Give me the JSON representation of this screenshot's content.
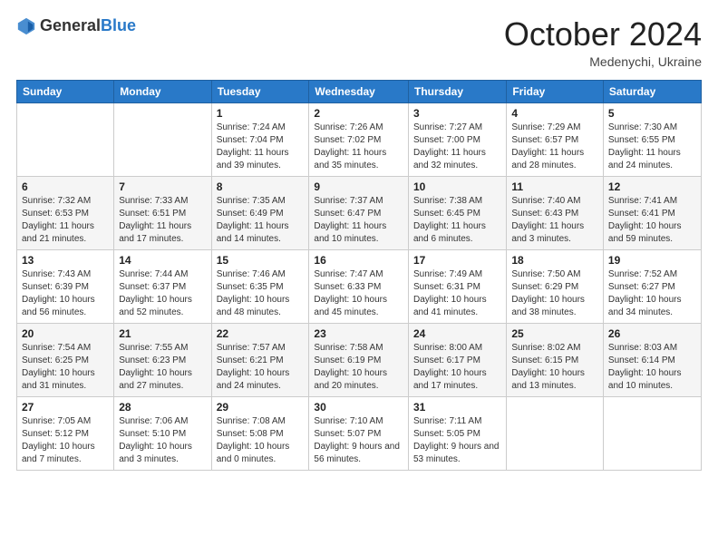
{
  "logo": {
    "general": "General",
    "blue": "Blue"
  },
  "header": {
    "month": "October 2024",
    "location": "Medenychi, Ukraine"
  },
  "weekdays": [
    "Sunday",
    "Monday",
    "Tuesday",
    "Wednesday",
    "Thursday",
    "Friday",
    "Saturday"
  ],
  "weeks": [
    [
      {
        "day": "",
        "info": ""
      },
      {
        "day": "",
        "info": ""
      },
      {
        "day": "1",
        "info": "Sunrise: 7:24 AM\nSunset: 7:04 PM\nDaylight: 11 hours and 39 minutes."
      },
      {
        "day": "2",
        "info": "Sunrise: 7:26 AM\nSunset: 7:02 PM\nDaylight: 11 hours and 35 minutes."
      },
      {
        "day": "3",
        "info": "Sunrise: 7:27 AM\nSunset: 7:00 PM\nDaylight: 11 hours and 32 minutes."
      },
      {
        "day": "4",
        "info": "Sunrise: 7:29 AM\nSunset: 6:57 PM\nDaylight: 11 hours and 28 minutes."
      },
      {
        "day": "5",
        "info": "Sunrise: 7:30 AM\nSunset: 6:55 PM\nDaylight: 11 hours and 24 minutes."
      }
    ],
    [
      {
        "day": "6",
        "info": "Sunrise: 7:32 AM\nSunset: 6:53 PM\nDaylight: 11 hours and 21 minutes."
      },
      {
        "day": "7",
        "info": "Sunrise: 7:33 AM\nSunset: 6:51 PM\nDaylight: 11 hours and 17 minutes."
      },
      {
        "day": "8",
        "info": "Sunrise: 7:35 AM\nSunset: 6:49 PM\nDaylight: 11 hours and 14 minutes."
      },
      {
        "day": "9",
        "info": "Sunrise: 7:37 AM\nSunset: 6:47 PM\nDaylight: 11 hours and 10 minutes."
      },
      {
        "day": "10",
        "info": "Sunrise: 7:38 AM\nSunset: 6:45 PM\nDaylight: 11 hours and 6 minutes."
      },
      {
        "day": "11",
        "info": "Sunrise: 7:40 AM\nSunset: 6:43 PM\nDaylight: 11 hours and 3 minutes."
      },
      {
        "day": "12",
        "info": "Sunrise: 7:41 AM\nSunset: 6:41 PM\nDaylight: 10 hours and 59 minutes."
      }
    ],
    [
      {
        "day": "13",
        "info": "Sunrise: 7:43 AM\nSunset: 6:39 PM\nDaylight: 10 hours and 56 minutes."
      },
      {
        "day": "14",
        "info": "Sunrise: 7:44 AM\nSunset: 6:37 PM\nDaylight: 10 hours and 52 minutes."
      },
      {
        "day": "15",
        "info": "Sunrise: 7:46 AM\nSunset: 6:35 PM\nDaylight: 10 hours and 48 minutes."
      },
      {
        "day": "16",
        "info": "Sunrise: 7:47 AM\nSunset: 6:33 PM\nDaylight: 10 hours and 45 minutes."
      },
      {
        "day": "17",
        "info": "Sunrise: 7:49 AM\nSunset: 6:31 PM\nDaylight: 10 hours and 41 minutes."
      },
      {
        "day": "18",
        "info": "Sunrise: 7:50 AM\nSunset: 6:29 PM\nDaylight: 10 hours and 38 minutes."
      },
      {
        "day": "19",
        "info": "Sunrise: 7:52 AM\nSunset: 6:27 PM\nDaylight: 10 hours and 34 minutes."
      }
    ],
    [
      {
        "day": "20",
        "info": "Sunrise: 7:54 AM\nSunset: 6:25 PM\nDaylight: 10 hours and 31 minutes."
      },
      {
        "day": "21",
        "info": "Sunrise: 7:55 AM\nSunset: 6:23 PM\nDaylight: 10 hours and 27 minutes."
      },
      {
        "day": "22",
        "info": "Sunrise: 7:57 AM\nSunset: 6:21 PM\nDaylight: 10 hours and 24 minutes."
      },
      {
        "day": "23",
        "info": "Sunrise: 7:58 AM\nSunset: 6:19 PM\nDaylight: 10 hours and 20 minutes."
      },
      {
        "day": "24",
        "info": "Sunrise: 8:00 AM\nSunset: 6:17 PM\nDaylight: 10 hours and 17 minutes."
      },
      {
        "day": "25",
        "info": "Sunrise: 8:02 AM\nSunset: 6:15 PM\nDaylight: 10 hours and 13 minutes."
      },
      {
        "day": "26",
        "info": "Sunrise: 8:03 AM\nSunset: 6:14 PM\nDaylight: 10 hours and 10 minutes."
      }
    ],
    [
      {
        "day": "27",
        "info": "Sunrise: 7:05 AM\nSunset: 5:12 PM\nDaylight: 10 hours and 7 minutes."
      },
      {
        "day": "28",
        "info": "Sunrise: 7:06 AM\nSunset: 5:10 PM\nDaylight: 10 hours and 3 minutes."
      },
      {
        "day": "29",
        "info": "Sunrise: 7:08 AM\nSunset: 5:08 PM\nDaylight: 10 hours and 0 minutes."
      },
      {
        "day": "30",
        "info": "Sunrise: 7:10 AM\nSunset: 5:07 PM\nDaylight: 9 hours and 56 minutes."
      },
      {
        "day": "31",
        "info": "Sunrise: 7:11 AM\nSunset: 5:05 PM\nDaylight: 9 hours and 53 minutes."
      },
      {
        "day": "",
        "info": ""
      },
      {
        "day": "",
        "info": ""
      }
    ]
  ]
}
